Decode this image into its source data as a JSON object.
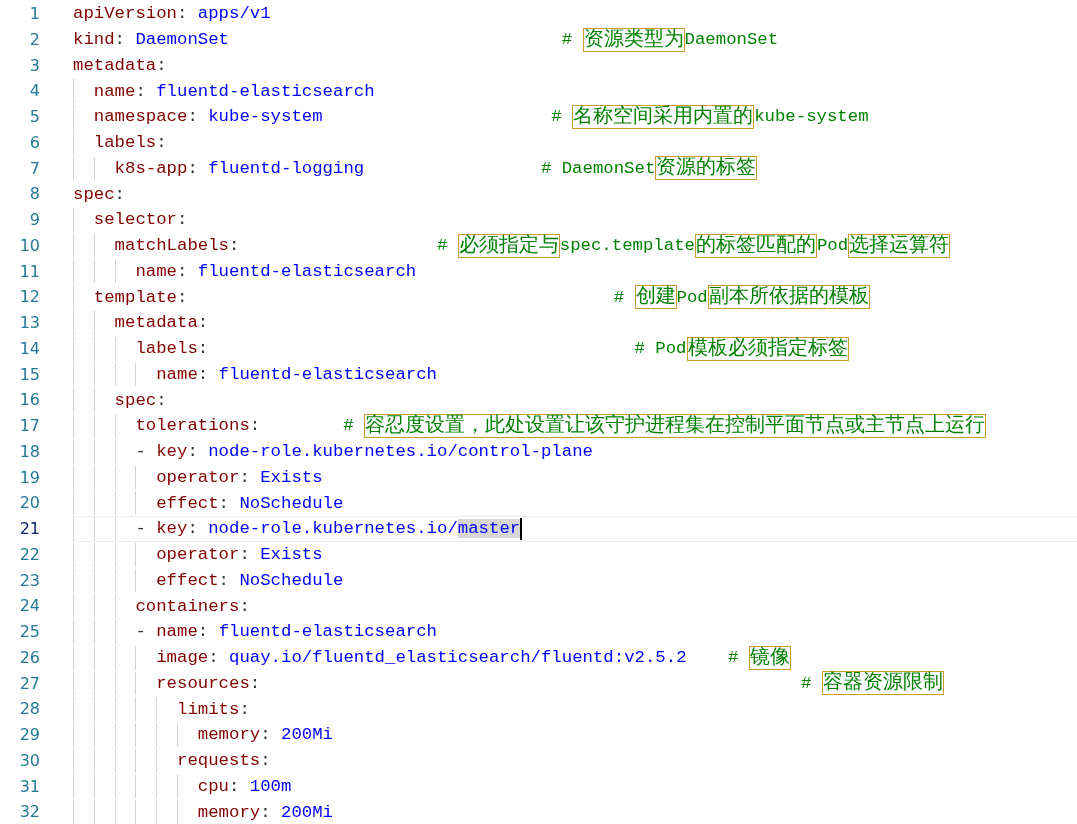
{
  "editor": {
    "lines": [
      {
        "number": "1",
        "current": false,
        "code": [
          {
            "kind": "key",
            "text": "apiVersion"
          },
          {
            "kind": "punct",
            "text": ": "
          },
          {
            "kind": "value",
            "text": "apps/v1"
          }
        ]
      },
      {
        "number": "2",
        "current": false,
        "code": [
          {
            "kind": "key",
            "text": "kind"
          },
          {
            "kind": "punct",
            "text": ": "
          },
          {
            "kind": "value",
            "text": "DaemonSet"
          }
        ],
        "comment": [
          {
            "text": "# ",
            "boxed": false
          },
          {
            "text": "资源类型为",
            "boxed": true
          },
          {
            "text": "DaemonSet",
            "boxed": false
          }
        ]
      },
      {
        "number": "3",
        "current": false,
        "code": [
          {
            "kind": "key",
            "text": "metadata"
          },
          {
            "kind": "punct",
            "text": ":"
          }
        ],
        "children": [
          {
            "number": "4",
            "current": false,
            "code": [
              {
                "kind": "key",
                "text": "name"
              },
              {
                "kind": "punct",
                "text": ": "
              },
              {
                "kind": "value",
                "text": "fluentd-elasticsearch"
              }
            ]
          },
          {
            "number": "5",
            "current": false,
            "code": [
              {
                "kind": "key",
                "text": "namespace"
              },
              {
                "kind": "punct",
                "text": ": "
              },
              {
                "kind": "value",
                "text": "kube-system"
              }
            ],
            "comment": [
              {
                "text": "# ",
                "boxed": false
              },
              {
                "text": "名称空间采用内置的",
                "boxed": true
              },
              {
                "text": "kube-system",
                "boxed": false
              }
            ]
          },
          {
            "number": "6",
            "current": false,
            "code": [
              {
                "kind": "key",
                "text": "labels"
              },
              {
                "kind": "punct",
                "text": ":"
              }
            ],
            "children": [
              {
                "number": "7",
                "current": false,
                "code": [
                  {
                    "kind": "key",
                    "text": "k8s-app"
                  },
                  {
                    "kind": "punct",
                    "text": ": "
                  },
                  {
                    "kind": "value",
                    "text": "fluentd-logging"
                  }
                ],
                "comment": [
                  {
                    "text": "# DaemonSet",
                    "boxed": false
                  },
                  {
                    "text": "资源的标签",
                    "boxed": true
                  }
                ]
              }
            ]
          }
        ]
      },
      {
        "number": "8",
        "current": false,
        "code": [
          {
            "kind": "key",
            "text": "spec"
          },
          {
            "kind": "punct",
            "text": ":"
          }
        ],
        "children": [
          {
            "number": "9",
            "current": false,
            "code": [
              {
                "kind": "key",
                "text": "selector"
              },
              {
                "kind": "punct",
                "text": ":"
              }
            ],
            "children": [
              {
                "number": "10",
                "current": false,
                "code": [
                  {
                    "kind": "key",
                    "text": "matchLabels"
                  },
                  {
                    "kind": "punct",
                    "text": ":"
                  }
                ],
                "comment": [
                  {
                    "text": "# ",
                    "boxed": false
                  },
                  {
                    "text": "必须指定与",
                    "boxed": true
                  },
                  {
                    "text": "spec.template",
                    "boxed": false
                  },
                  {
                    "text": "的标签匹配的",
                    "boxed": true
                  },
                  {
                    "text": "Pod",
                    "boxed": false
                  },
                  {
                    "text": "选择运算符",
                    "boxed": true
                  }
                ],
                "children": [
                  {
                    "number": "11",
                    "current": false,
                    "code": [
                      {
                        "kind": "key",
                        "text": "name"
                      },
                      {
                        "kind": "punct",
                        "text": ": "
                      },
                      {
                        "kind": "value",
                        "text": "fluentd-elasticsearch"
                      }
                    ]
                  }
                ]
              }
            ]
          },
          {
            "number": "12",
            "current": false,
            "code": [
              {
                "kind": "key",
                "text": "template"
              },
              {
                "kind": "punct",
                "text": ":"
              }
            ],
            "comment": [
              {
                "text": "# ",
                "boxed": false
              },
              {
                "text": "创建",
                "boxed": true
              },
              {
                "text": "Pod",
                "boxed": false
              },
              {
                "text": "副本所依据的模板",
                "boxed": true
              }
            ],
            "children": [
              {
                "number": "13",
                "current": false,
                "code": [
                  {
                    "kind": "key",
                    "text": "metadata"
                  },
                  {
                    "kind": "punct",
                    "text": ":"
                  }
                ],
                "children": [
                  {
                    "number": "14",
                    "current": false,
                    "code": [
                      {
                        "kind": "key",
                        "text": "labels"
                      },
                      {
                        "kind": "punct",
                        "text": ":"
                      }
                    ],
                    "comment": [
                      {
                        "text": "# Pod",
                        "boxed": false
                      },
                      {
                        "text": "模板必须指定标签",
                        "boxed": true
                      }
                    ],
                    "children": [
                      {
                        "number": "15",
                        "current": false,
                        "code": [
                          {
                            "kind": "key",
                            "text": "name"
                          },
                          {
                            "kind": "punct",
                            "text": ": "
                          },
                          {
                            "kind": "value",
                            "text": "fluentd-elasticsearch"
                          }
                        ]
                      }
                    ]
                  }
                ]
              },
              {
                "number": "16",
                "current": false,
                "code": [
                  {
                    "kind": "key",
                    "text": "spec"
                  },
                  {
                    "kind": "punct",
                    "text": ":"
                  }
                ],
                "children": [
                  {
                    "number": "17",
                    "current": false,
                    "code": [
                      {
                        "kind": "key",
                        "text": "tolerations"
                      },
                      {
                        "kind": "punct",
                        "text": ":"
                      }
                    ],
                    "comment": [
                      {
                        "text": "# ",
                        "boxed": false
                      },
                      {
                        "text": "容忍度设置，此处设置让该守护进程集在控制平面节点或主节点上运行",
                        "boxed": true
                      }
                    ]
                  },
                  {
                    "number": "18",
                    "current": false,
                    "code": [
                      {
                        "kind": "punct",
                        "text": "- "
                      },
                      {
                        "kind": "key",
                        "text": "key"
                      },
                      {
                        "kind": "punct",
                        "text": ": "
                      },
                      {
                        "kind": "value",
                        "text": "node-role.kubernetes.io/control-plane"
                      }
                    ],
                    "children": [
                      {
                        "number": "19",
                        "current": false,
                        "code": [
                          {
                            "kind": "key",
                            "text": "operator"
                          },
                          {
                            "kind": "punct",
                            "text": ": "
                          },
                          {
                            "kind": "value",
                            "text": "Exists"
                          }
                        ]
                      },
                      {
                        "number": "20",
                        "current": false,
                        "code": [
                          {
                            "kind": "key",
                            "text": "effect"
                          },
                          {
                            "kind": "punct",
                            "text": ": "
                          },
                          {
                            "kind": "value",
                            "text": "NoSchedule"
                          }
                        ]
                      }
                    ]
                  },
                  {
                    "number": "21",
                    "current": true,
                    "code": [
                      {
                        "kind": "punct",
                        "text": "- "
                      },
                      {
                        "kind": "key",
                        "text": "key"
                      },
                      {
                        "kind": "punct",
                        "text": ": "
                      },
                      {
                        "kind": "value",
                        "text": "node-role.kubernetes.io/"
                      },
                      {
                        "kind": "value",
                        "text": "master",
                        "selected": true
                      }
                    ],
                    "children": [
                      {
                        "number": "22",
                        "current": false,
                        "code": [
                          {
                            "kind": "key",
                            "text": "operator"
                          },
                          {
                            "kind": "punct",
                            "text": ": "
                          },
                          {
                            "kind": "value",
                            "text": "Exists"
                          }
                        ]
                      },
                      {
                        "number": "23",
                        "current": false,
                        "code": [
                          {
                            "kind": "key",
                            "text": "effect"
                          },
                          {
                            "kind": "punct",
                            "text": ": "
                          },
                          {
                            "kind": "value",
                            "text": "NoSchedule"
                          }
                        ]
                      }
                    ]
                  },
                  {
                    "number": "24",
                    "current": false,
                    "code": [
                      {
                        "kind": "key",
                        "text": "containers"
                      },
                      {
                        "kind": "punct",
                        "text": ":"
                      }
                    ]
                  },
                  {
                    "number": "25",
                    "current": false,
                    "code": [
                      {
                        "kind": "punct",
                        "text": "- "
                      },
                      {
                        "kind": "key",
                        "text": "name"
                      },
                      {
                        "kind": "punct",
                        "text": ": "
                      },
                      {
                        "kind": "value",
                        "text": "fluentd-elasticsearch"
                      }
                    ],
                    "children": [
                      {
                        "number": "26",
                        "current": false,
                        "code": [
                          {
                            "kind": "key",
                            "text": "image"
                          },
                          {
                            "kind": "punct",
                            "text": ": "
                          },
                          {
                            "kind": "value",
                            "text": "quay.io/fluentd_elasticsearch/fluentd:v2.5.2"
                          }
                        ],
                        "comment": [
                          {
                            "text": "# ",
                            "boxed": false
                          },
                          {
                            "text": "镜像",
                            "boxed": true
                          }
                        ]
                      },
                      {
                        "number": "27",
                        "current": false,
                        "code": [
                          {
                            "kind": "key",
                            "text": "resources"
                          },
                          {
                            "kind": "punct",
                            "text": ":"
                          }
                        ],
                        "comment": [
                          {
                            "text": "# ",
                            "boxed": false
                          },
                          {
                            "text": "容器资源限制",
                            "boxed": true
                          }
                        ],
                        "children": [
                          {
                            "number": "28",
                            "current": false,
                            "code": [
                              {
                                "kind": "key",
                                "text": "limits"
                              },
                              {
                                "kind": "punct",
                                "text": ":"
                              }
                            ],
                            "children": [
                              {
                                "number": "29",
                                "current": false,
                                "code": [
                                  {
                                    "kind": "key",
                                    "text": "memory"
                                  },
                                  {
                                    "kind": "punct",
                                    "text": ": "
                                  },
                                  {
                                    "kind": "value",
                                    "text": "200Mi"
                                  }
                                ]
                              }
                            ]
                          },
                          {
                            "number": "30",
                            "current": false,
                            "code": [
                              {
                                "kind": "key",
                                "text": "requests"
                              },
                              {
                                "kind": "punct",
                                "text": ":"
                              }
                            ],
                            "children": [
                              {
                                "number": "31",
                                "current": false,
                                "code": [
                                  {
                                    "kind": "key",
                                    "text": "cpu"
                                  },
                                  {
                                    "kind": "punct",
                                    "text": ": "
                                  },
                                  {
                                    "kind": "value",
                                    "text": "100m"
                                  }
                                ]
                              },
                              {
                                "number": "32",
                                "current": false,
                                "code": [
                                  {
                                    "kind": "key",
                                    "text": "memory"
                                  },
                                  {
                                    "kind": "punct",
                                    "text": ": "
                                  },
                                  {
                                    "kind": "value",
                                    "text": "200Mi"
                                  }
                                ]
                              }
                            ]
                          }
                        ]
                      }
                    ]
                  }
                ]
              }
            ]
          }
        ]
      }
    ]
  }
}
